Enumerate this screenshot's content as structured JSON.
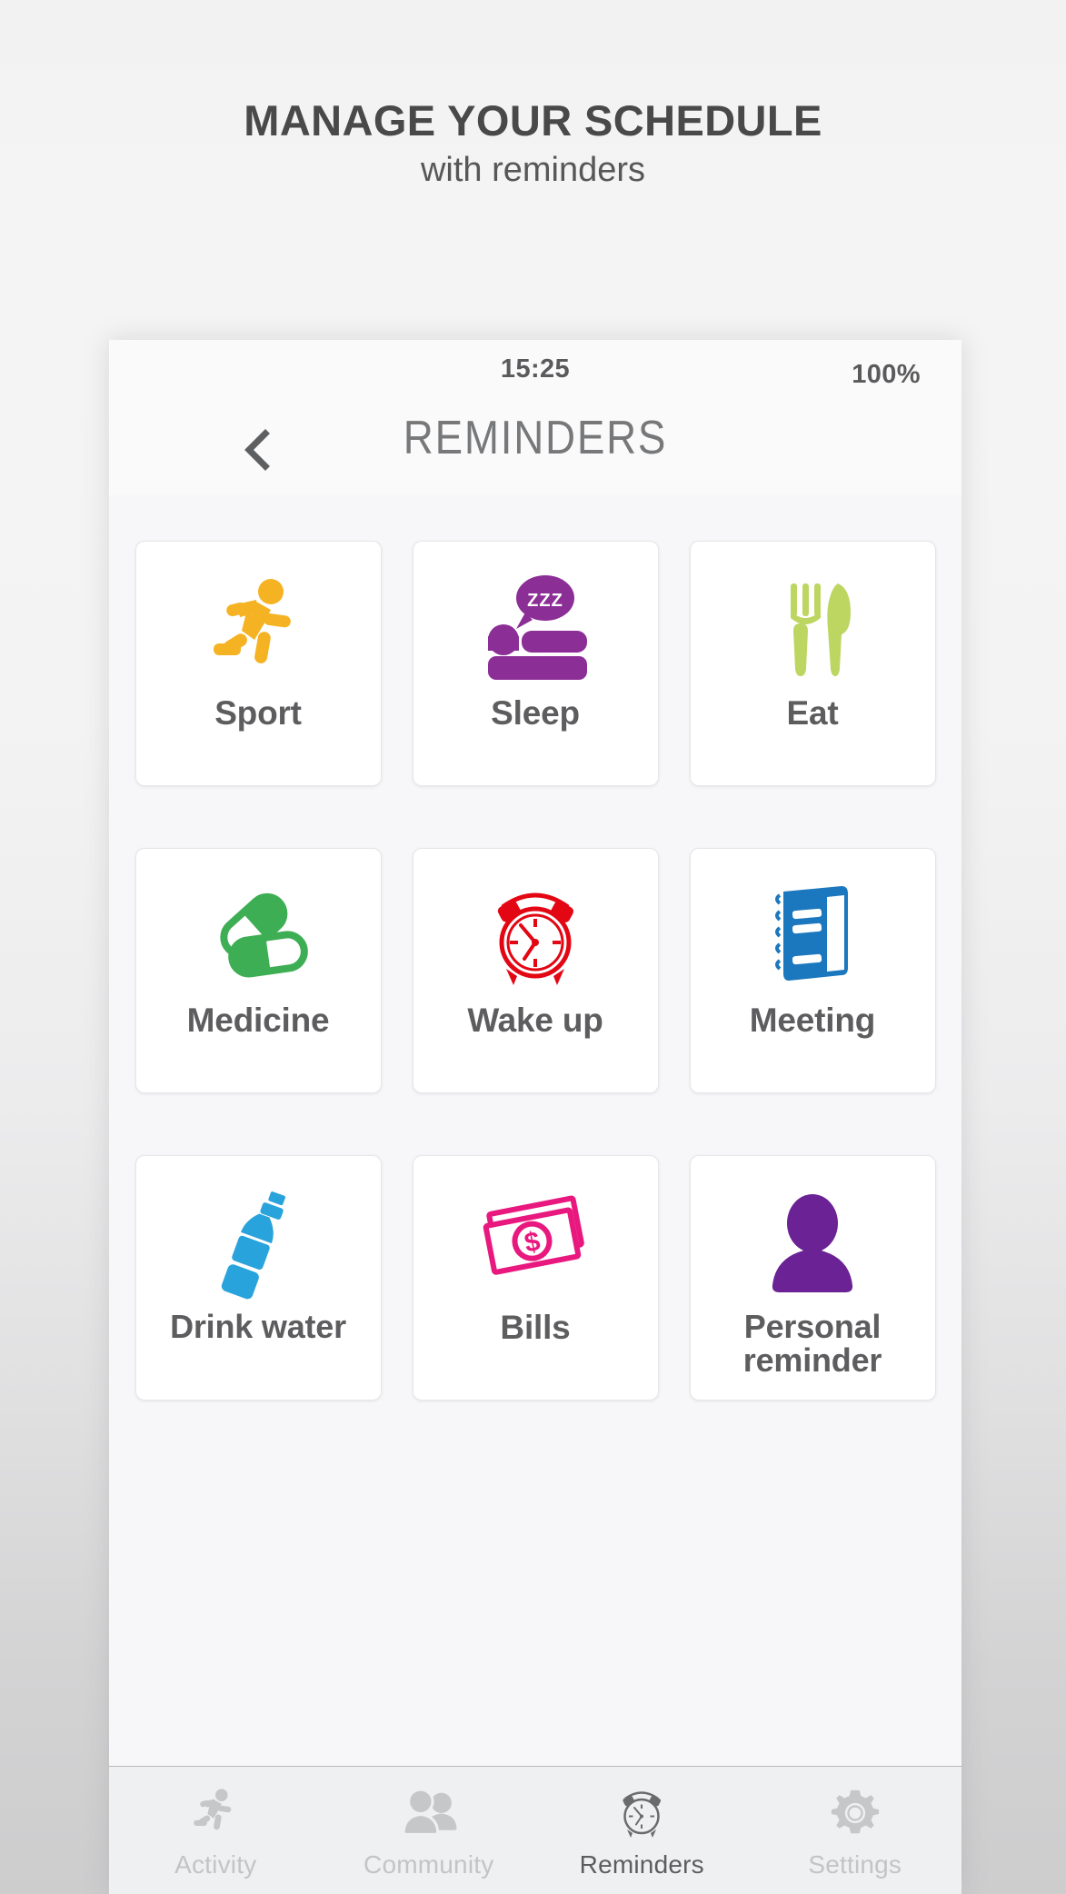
{
  "promo": {
    "title": "MANAGE YOUR SCHEDULE",
    "subtitle": "with reminders"
  },
  "phone": {
    "status_bar": {
      "time": "15:25",
      "battery": "100%"
    },
    "header": {
      "back_icon": "chevron-left-icon",
      "title": "REMINDERS"
    },
    "reminders": [
      {
        "label": "Sport",
        "icon": "running-person-icon",
        "color": "#F5B324"
      },
      {
        "label": "Sleep",
        "icon": "bed-zzz-icon",
        "color": "#8B2E96"
      },
      {
        "label": "Eat",
        "icon": "fork-knife-icon",
        "color": "#BDD661"
      },
      {
        "label": "Medicine",
        "icon": "pills-icon",
        "color": "#3EAE54"
      },
      {
        "label": "Wake up",
        "icon": "alarm-clock-icon",
        "color": "#E30613"
      },
      {
        "label": "Meeting",
        "icon": "notebook-icon",
        "color": "#1C78BE"
      },
      {
        "label": "Drink water",
        "icon": "water-bottle-icon",
        "color": "#29A3DC"
      },
      {
        "label": "Bills",
        "icon": "banknotes-icon",
        "color": "#E8187E"
      },
      {
        "label": "Personal reminder",
        "icon": "person-icon",
        "color": "#6A2294"
      }
    ],
    "tabs": [
      {
        "label": "Activity",
        "icon": "running-person-icon",
        "active": false
      },
      {
        "label": "Community",
        "icon": "people-icon",
        "active": false
      },
      {
        "label": "Reminders",
        "icon": "alarm-clock-icon",
        "active": true
      },
      {
        "label": "Settings",
        "icon": "gear-icon",
        "active": false
      }
    ]
  },
  "colors": {
    "inactive_tab": "#c3c4c6",
    "active_tab": "#5c5d5f",
    "tile_label": "#5d5d5f"
  }
}
